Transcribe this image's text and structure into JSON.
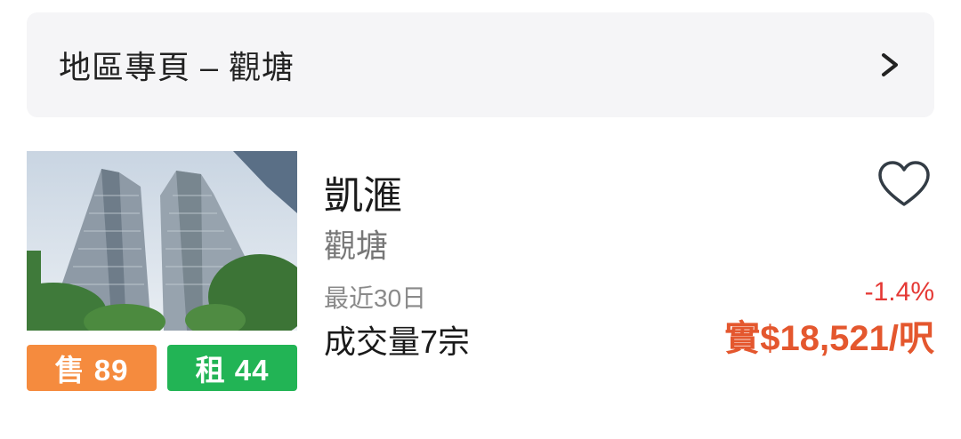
{
  "region_bar": {
    "title": "地區專頁 – 觀塘",
    "icon": "chevron-right-icon"
  },
  "estate": {
    "name": "凱滙",
    "district": "觀塘",
    "period_label": "最近30日",
    "volume_text": "成交量7宗",
    "price_change": "-1.4%",
    "price_per_sqft": "實$18,521/呎",
    "sale_badge": "售 89",
    "rent_badge": "租 44",
    "favorite_icon": "heart-outline-icon"
  },
  "colors": {
    "sale": "#f58b3e",
    "rent": "#22b455",
    "change_negative": "#e53935",
    "price": "#e4572e",
    "bar_bg": "#f5f5f7"
  }
}
